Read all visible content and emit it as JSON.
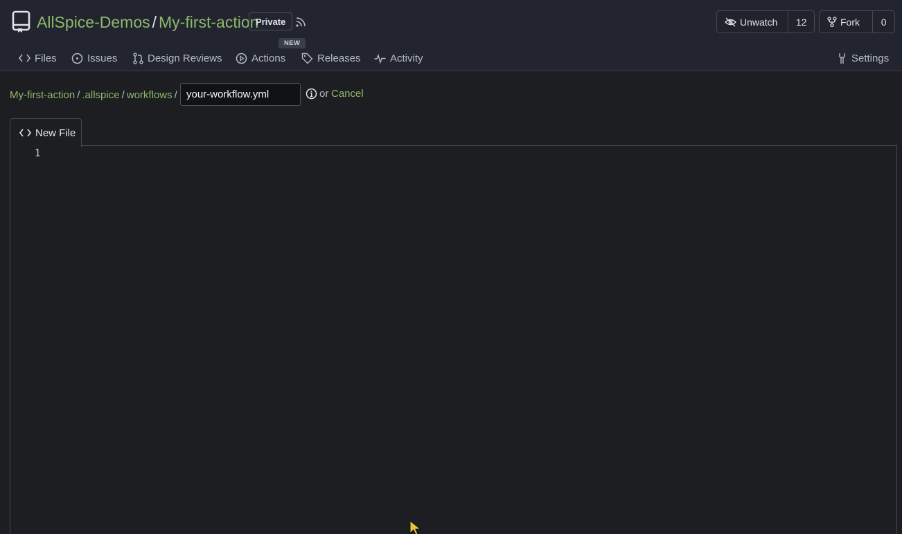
{
  "header": {
    "owner": "AllSpice-Demos",
    "separator": "/",
    "repo": "My-first-action",
    "visibility_badge": "Private",
    "new_badge": "NEW",
    "watch": {
      "label": "Unwatch",
      "count": "12"
    },
    "fork": {
      "label": "Fork",
      "count": "0"
    }
  },
  "nav": {
    "items": [
      {
        "label": "Files",
        "icon": "code-icon"
      },
      {
        "label": "Issues",
        "icon": "issue-icon"
      },
      {
        "label": "Design Reviews",
        "icon": "pull-request-icon"
      },
      {
        "label": "Actions",
        "icon": "play-icon"
      },
      {
        "label": "Releases",
        "icon": "tag-icon"
      },
      {
        "label": "Activity",
        "icon": "pulse-icon"
      }
    ],
    "settings": {
      "label": "Settings",
      "icon": "tools-icon"
    }
  },
  "breadcrumb": {
    "items": [
      "My-first-action",
      ".allspice",
      "workflows"
    ],
    "separator": "/"
  },
  "filename": {
    "value": "your-workflow.yml"
  },
  "or_text": "or",
  "cancel_label": "Cancel",
  "editor": {
    "tab_label": "New File",
    "line_numbers": [
      "1"
    ]
  },
  "colors": {
    "accent": "#8fb86a",
    "background": "#1c1e21",
    "header_background": "#222530",
    "border": "#454a54"
  }
}
